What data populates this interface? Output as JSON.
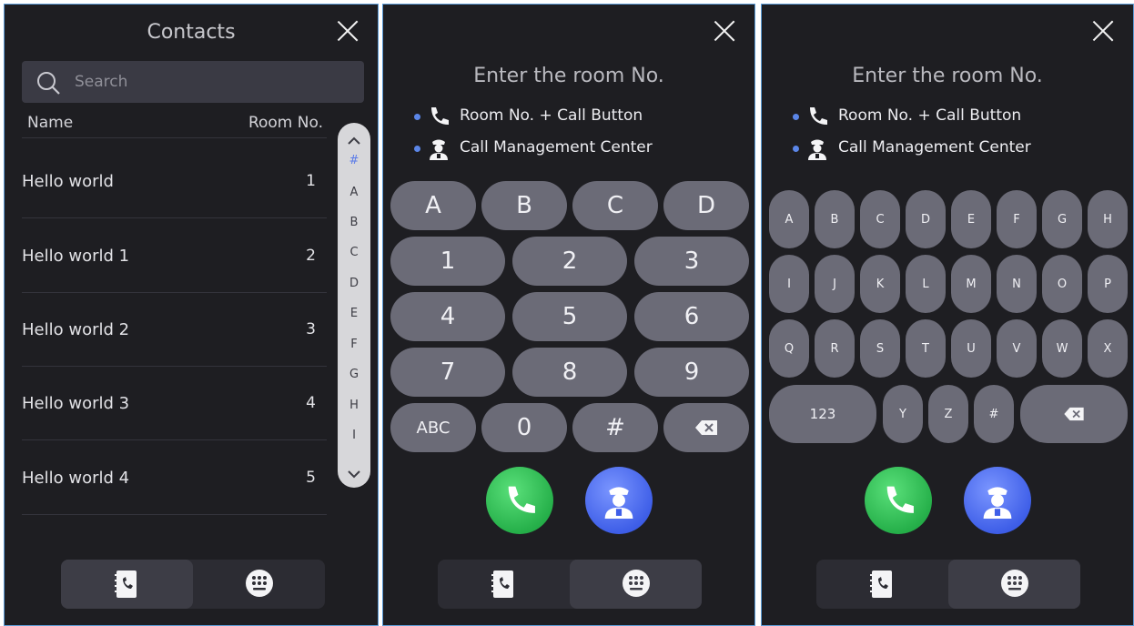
{
  "contacts": {
    "title": "Contacts",
    "search_placeholder": "Search",
    "col_name": "Name",
    "col_room": "Room No.",
    "rows": [
      {
        "name": "Hello world",
        "room": "1"
      },
      {
        "name": "Hello world 1",
        "room": "2"
      },
      {
        "name": "Hello world 2",
        "room": "3"
      },
      {
        "name": "Hello world 3",
        "room": "4"
      },
      {
        "name": "Hello world 4",
        "room": "5"
      }
    ],
    "index": [
      "#",
      "A",
      "B",
      "C",
      "D",
      "E",
      "F",
      "G",
      "H",
      "I"
    ],
    "active_index": "#"
  },
  "dial": {
    "subtitle": "Enter the room No.",
    "hint_call": "Room No. + Call Button",
    "hint_center": "Call Management Center",
    "letter_row": [
      "A",
      "B",
      "C",
      "D"
    ],
    "numpad": [
      "1",
      "2",
      "3",
      "4",
      "5",
      "6",
      "7",
      "8",
      "9"
    ],
    "abc_label": "ABC",
    "zero_label": "0",
    "hash_label": "#"
  },
  "keyboard": {
    "row1": [
      "A",
      "B",
      "C",
      "D",
      "E",
      "F",
      "G",
      "H"
    ],
    "row2": [
      "I",
      "J",
      "K",
      "L",
      "M",
      "N",
      "O",
      "P"
    ],
    "row3": [
      "Q",
      "R",
      "S",
      "T",
      "U",
      "V",
      "W",
      "X"
    ],
    "num_label": "123",
    "row4": [
      "Y",
      "Z",
      "#"
    ]
  },
  "icons": {
    "close": "close-icon",
    "search": "search-icon",
    "phone": "phone-icon",
    "guard": "security-guard-icon",
    "contacts_book": "contacts-book-icon",
    "keypad": "keypad-icon",
    "backspace": "backspace-icon"
  },
  "colors": {
    "panel_bg": "#1e1e22",
    "key_bg": "#6b6b77",
    "call_green": "#26b04a",
    "call_blue": "#3f5fe8",
    "accent_dot": "#5b86e8",
    "border": "#5b9bd6"
  }
}
